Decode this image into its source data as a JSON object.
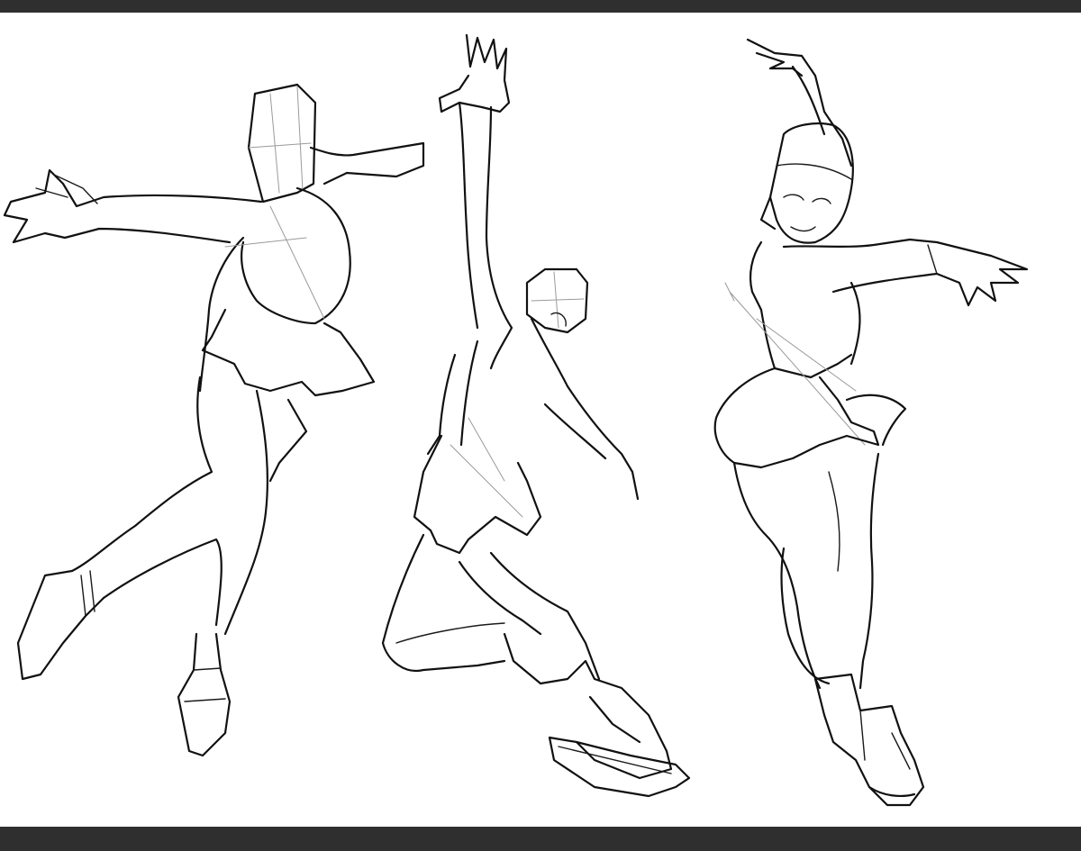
{
  "colors": {
    "frame_bar": "#2f2f2f",
    "canvas": "#ffffff",
    "ink": "#111111",
    "construction_line": "#9a9a9a"
  },
  "figures": [
    {
      "pose": "reaching-arms-out"
    },
    {
      "pose": "arm-raised-leaning"
    },
    {
      "pose": "arm-raised-spin"
    }
  ]
}
